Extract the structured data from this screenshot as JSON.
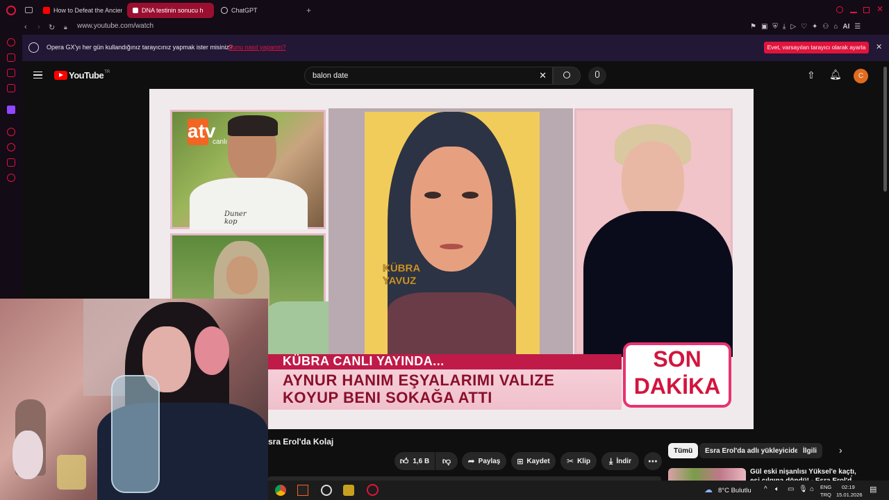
{
  "browser": {
    "tabs": [
      {
        "label": "How to Defeat the Ancient",
        "active": false
      },
      {
        "label": "DNA testinin sonucu h",
        "active": true
      },
      {
        "label": "ChatGPT",
        "active": false
      }
    ],
    "url": "www.youtube.com/watch",
    "new_tab": "+"
  },
  "banner": {
    "message": "Opera GX'yı her gün kullandığınız tarayıcınız yapmak ister misiniz?",
    "link": "Bunu nasıl yaparım?",
    "cta": "Evet, varsayılan tarayıcı olarak ayarla",
    "close": "✕"
  },
  "youtube": {
    "logo_text": "YouTube",
    "region": "TR",
    "search_value": "balon date",
    "avatar_letter": "C"
  },
  "thumbnail": {
    "channel_logo": "atv",
    "channel_sub": "canlı",
    "name_caption_1": "KÜBRA",
    "name_caption_2": "YAVUZ",
    "ticker_line_1": "KÜBRA CANLI YAYINDA...",
    "ticker_line_2": "AYNUR HANIM EŞYALARIMI VALIZE",
    "ticker_line_3": "KOYUP BENI SOKAĞA ATTI",
    "badge_line_1": "SON",
    "badge_line_2": "DAKİKA",
    "shirt_text": "Duner\nkop"
  },
  "video_info": {
    "title_fragment": "sra Erol'da Kolaj",
    "like_count": "1,6 B",
    "share": "Paylaş",
    "save": "Kaydet",
    "clip": "Klip",
    "download": "İndir",
    "more": "⋯"
  },
  "filters": {
    "chips": [
      "Tümü",
      "Esra Erol'da adlı yükleyiciden",
      "İlgili"
    ]
  },
  "recommended": {
    "title_line_1": "Gül eski nişanlısı Yüksel'e kaçtı,",
    "title_line_2": "eşi çılgına döndü! - Esra Erol'd"
  },
  "taskbar": {
    "weather": "8°C Bulutlu",
    "lang_1": "ENG",
    "lang_2": "TRQ",
    "time": "02:19",
    "date": "15.01.2026"
  },
  "colors": {
    "opera_red": "#e0143c",
    "youtube_red": "#ff0000",
    "banner_bg": "#231736",
    "avatar": "#e06c1f"
  }
}
